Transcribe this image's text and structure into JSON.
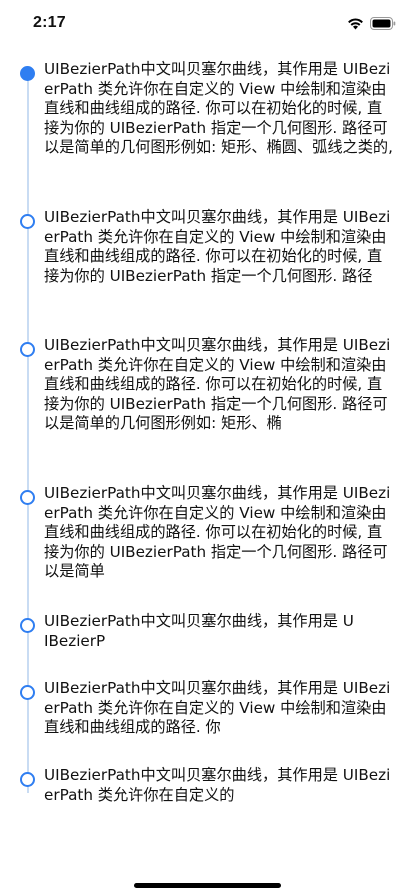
{
  "status_bar": {
    "time": "2:17"
  },
  "timeline": {
    "items": [
      {
        "text": "UIBezierPath中文叫贝塞尔曲线，其作用是 UIBezierPath 类允许你在自定义的 View 中绘制和渲染由直线和曲线组成的路径. 你可以在初始化的时候, 直接为你的 UIBezierPath 指定一个几何图形. 路径可以是简单的几何图形例如: 矩形、椭圆、弧线之类的,",
        "active": true
      },
      {
        "text": "UIBezierPath中文叫贝塞尔曲线，其作用是 UIBezierPath 类允许你在自定义的 View 中绘制和渲染由直线和曲线组成的路径. 你可以在初始化的时候, 直接为你的 UIBezierPath 指定一个几何图形. 路径",
        "active": false
      },
      {
        "text": "UIBezierPath中文叫贝塞尔曲线，其作用是 UIBezierPath 类允许你在自定义的 View 中绘制和渲染由直线和曲线组成的路径. 你可以在初始化的时候, 直接为你的 UIBezierPath 指定一个几何图形. 路径可以是简单的几何图形例如: 矩形、椭",
        "active": false
      },
      {
        "text": "UIBezierPath中文叫贝塞尔曲线，其作用是 UIBezierPath 类允许你在自定义的 View 中绘制和渲染由直线和曲线组成的路径. 你可以在初始化的时候, 直接为你的 UIBezierPath 指定一个几何图形. 路径可以是简单",
        "active": false
      },
      {
        "text": "UIBezierPath中文叫贝塞尔曲线，其作用是 UIBezierP",
        "active": false
      },
      {
        "text": "UIBezierPath中文叫贝塞尔曲线，其作用是 UIBezierPath 类允许你在自定义的 View 中绘制和渲染由直线和曲线组成的路径. 你",
        "active": false
      },
      {
        "text": "UIBezierPath中文叫贝塞尔曲线，其作用是 UIBezierPath 类允许你在自定义的",
        "active": false
      }
    ]
  },
  "colors": {
    "accent": "#2f7ef1",
    "line": "#c9dcf3",
    "text": "#111111"
  },
  "icons": [
    "wifi-icon",
    "battery-icon"
  ]
}
